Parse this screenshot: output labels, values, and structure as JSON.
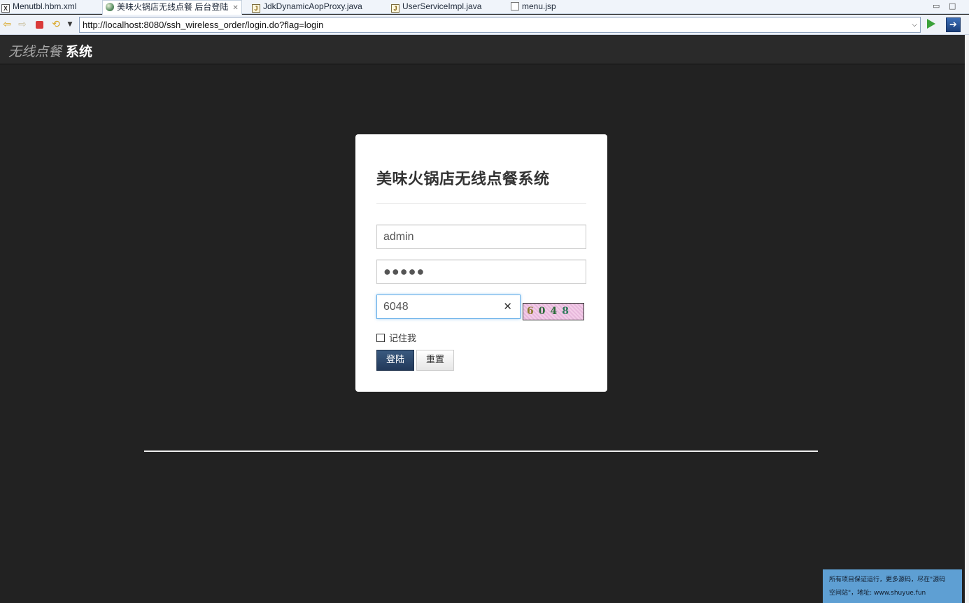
{
  "tabs": [
    {
      "label": "Menutbl.hbm.xml",
      "icon": "xml-file-icon"
    },
    {
      "label": "美味火锅店无线点餐 后台登陆",
      "icon": "browser-globe-icon",
      "active": true
    },
    {
      "label": "JdkDynamicAopProxy.java",
      "icon": "java-class-icon"
    },
    {
      "label": "UserServiceImpl.java",
      "icon": "java-class-icon"
    },
    {
      "label": "menu.jsp",
      "icon": "jsp-file-icon"
    }
  ],
  "browser": {
    "url": "http://localhost:8080/ssh_wireless_order/login.do?flag=login"
  },
  "navbar": {
    "brand_light": "无线点餐",
    "brand_bold": "系统"
  },
  "login": {
    "title": "美味火锅店无线点餐系统",
    "username": "admin",
    "password_masked": "●●●●●",
    "code": "6048",
    "captcha_chars": [
      "6",
      "0",
      "4",
      "8"
    ],
    "remember_label": "记住我",
    "login_label": "登陆",
    "reset_label": "重置"
  },
  "footer_note": {
    "line1": "所有项目保证运行，更多源码，尽在\"源码",
    "line2": "空间站\"，地址: www.shuyue.fun"
  },
  "colors": {
    "page_bg": "#222222",
    "navbar_bg": "#2a2a2a",
    "primary_button": "#2c4a6e",
    "footer_note_bg": "#5e9fd3"
  }
}
